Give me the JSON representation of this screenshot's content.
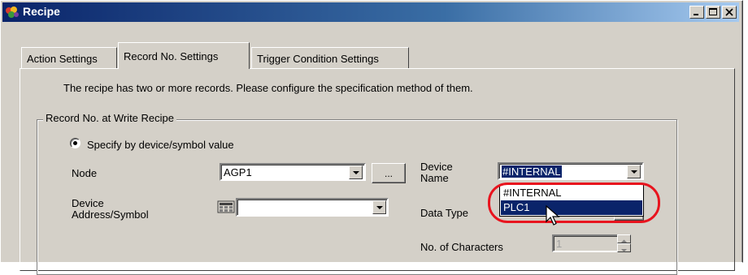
{
  "window": {
    "title": "Recipe"
  },
  "tabs": [
    {
      "label": "Action Settings"
    },
    {
      "label": "Record No. Settings"
    },
    {
      "label": "Trigger Condition Settings"
    }
  ],
  "intro_text": "The recipe has two or more records. Please configure the specification method of them.",
  "group": {
    "label": "Record No. at Write Recipe",
    "radio_label": "Specify by device/symbol value",
    "node_label": "Node",
    "node_value": "AGP1",
    "browse_label": "...",
    "device_address_label_1": "Device",
    "device_address_label_2": "Address/Symbol",
    "device_address_value": "",
    "device_name_label_1": "Device",
    "device_name_label_2": "Name",
    "device_name_value": "#INTERNAL",
    "device_name_options": [
      "#INTERNAL",
      "PLC1"
    ],
    "data_type_label": "Data Type",
    "chars_label": "No. of Characters",
    "chars_value": "1"
  },
  "colors": {
    "highlight_ring": "#e8141e",
    "selection": "#0a246a"
  }
}
